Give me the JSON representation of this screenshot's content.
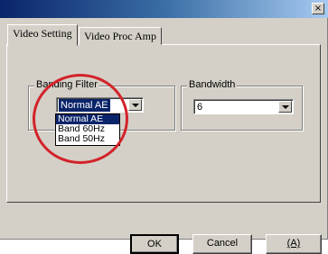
{
  "window": {
    "close_label": "×"
  },
  "tabs": [
    {
      "label": "Video Setting"
    },
    {
      "label": "Video Proc Amp"
    }
  ],
  "banding_filter": {
    "label": "Banding Filter",
    "selected": "Normal AE",
    "options": [
      "Normal AE",
      "Band 60Hz",
      "Band 50Hz"
    ]
  },
  "bandwidth": {
    "label": "Bandwidth",
    "selected": "6"
  },
  "buttons": {
    "ok": "OK",
    "cancel": "Cancel",
    "aux": "(A)"
  },
  "colors": {
    "highlight": "#0a246a",
    "annotation": "#d3232a",
    "dialog": "#d4d0c8"
  }
}
